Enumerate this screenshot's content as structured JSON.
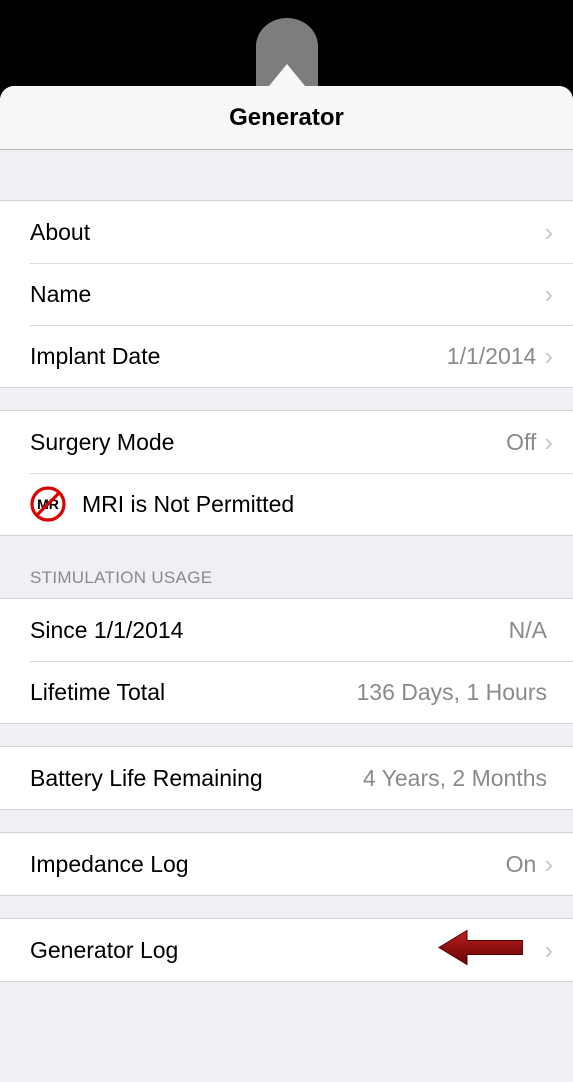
{
  "header": {
    "title": "Generator"
  },
  "groups": {
    "about": {
      "label": "About"
    },
    "name": {
      "label": "Name"
    },
    "implant_date": {
      "label": "Implant Date",
      "value": "1/1/2014"
    },
    "surgery_mode": {
      "label": "Surgery Mode",
      "value": "Off"
    },
    "mri": {
      "label": "MRI is Not Permitted",
      "icon_text": "MR"
    },
    "stim_usage_header": "STIMULATION USAGE",
    "since": {
      "label": "Since 1/1/2014",
      "value": "N/A"
    },
    "lifetime": {
      "label": "Lifetime Total",
      "value": "136 Days, 1 Hours"
    },
    "battery": {
      "label": "Battery Life Remaining",
      "value": "4 Years, 2 Months"
    },
    "impedance": {
      "label": "Impedance Log",
      "value": "On"
    },
    "genlog": {
      "label": "Generator Log"
    }
  }
}
